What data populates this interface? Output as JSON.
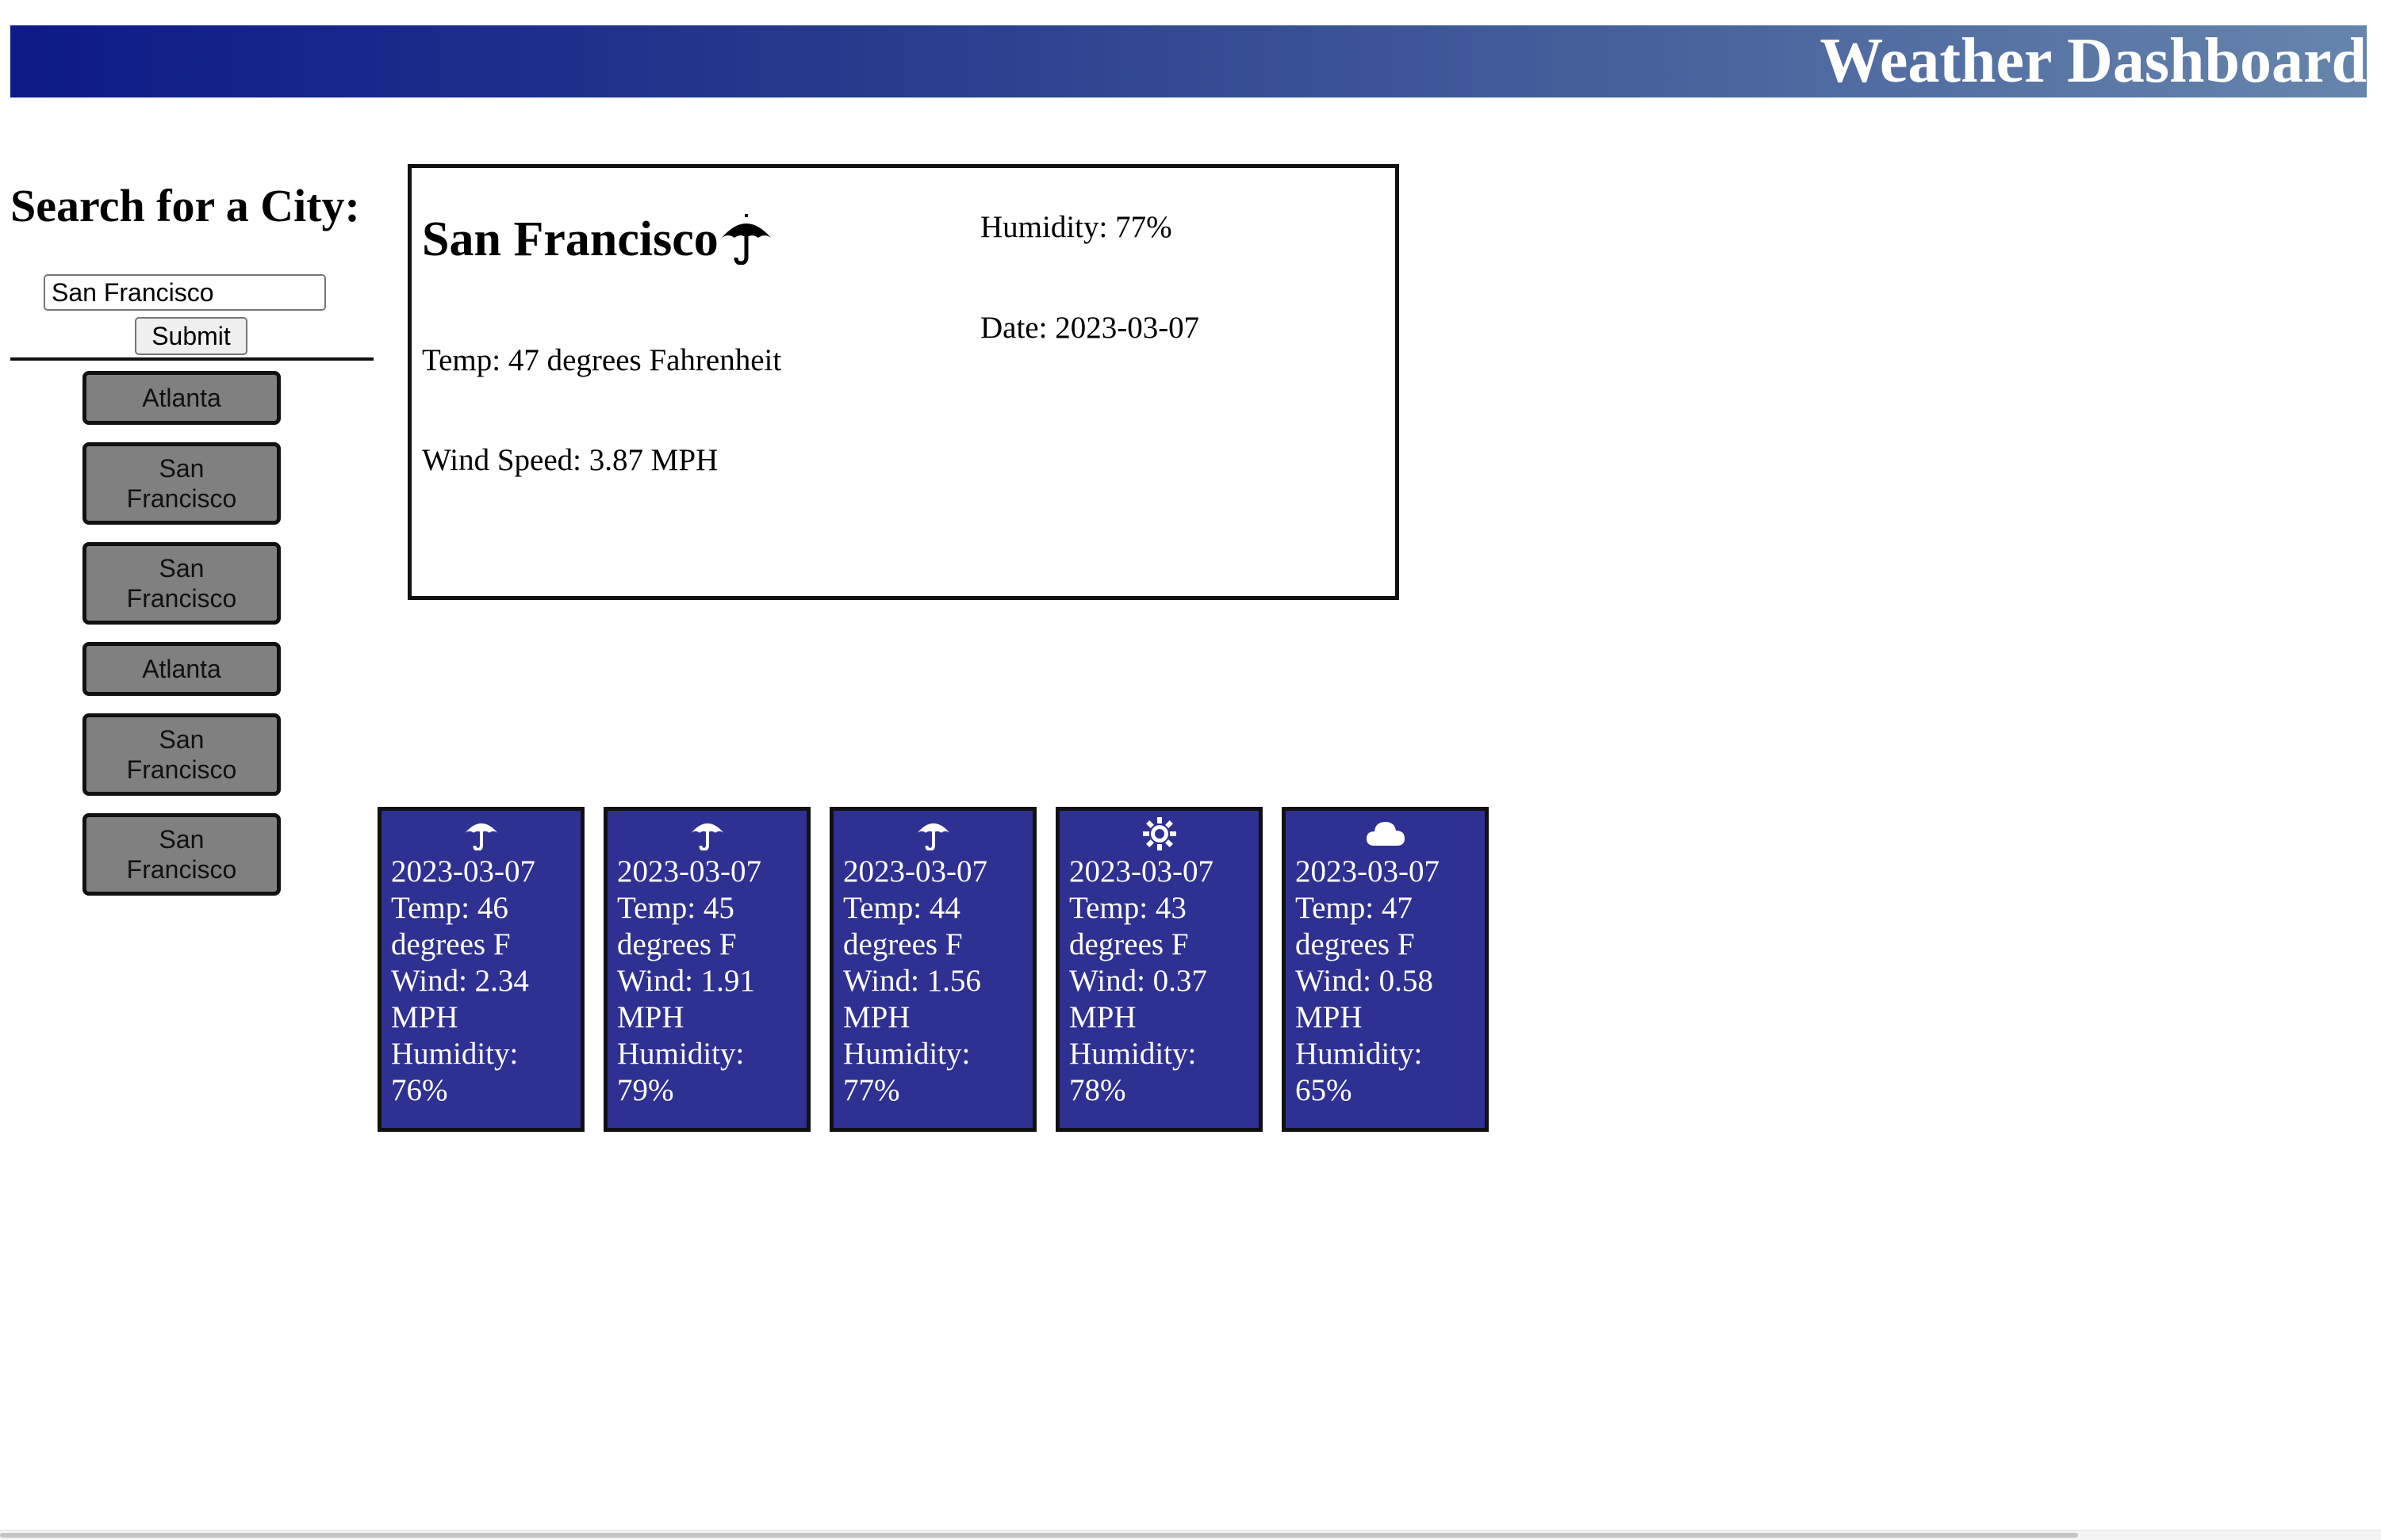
{
  "header": {
    "title": "Weather Dashboard"
  },
  "search": {
    "heading": "Search for a City:",
    "input_value": "San Francisco",
    "submit_label": "Submit"
  },
  "history": [
    {
      "label": "Atlanta"
    },
    {
      "label": "San Francisco"
    },
    {
      "label": "San Francisco"
    },
    {
      "label": "Atlanta"
    },
    {
      "label": "San Francisco"
    },
    {
      "label": "San Francisco"
    }
  ],
  "current": {
    "city": "San Francisco",
    "icon": "umbrella-icon",
    "temp": "Temp: 47 degrees Fahrenheit",
    "wind": "Wind Speed: 3.87 MPH",
    "humidity": "Humidity: 77%",
    "date": "Date: 2023-03-07"
  },
  "forecast": [
    {
      "icon": "umbrella-icon",
      "date": "2023-03-07",
      "temp_a": "Temp: 46",
      "temp_b": "degrees F",
      "wind_a": "Wind: 2.34",
      "wind_b": "MPH",
      "hum_a": "Humidity:",
      "hum_b": "76%"
    },
    {
      "icon": "umbrella-icon",
      "date": "2023-03-07",
      "temp_a": "Temp: 45",
      "temp_b": "degrees F",
      "wind_a": "Wind: 1.91",
      "wind_b": "MPH",
      "hum_a": "Humidity:",
      "hum_b": "79%"
    },
    {
      "icon": "umbrella-icon",
      "date": "2023-03-07",
      "temp_a": "Temp: 44",
      "temp_b": "degrees F",
      "wind_a": "Wind: 1.56",
      "wind_b": "MPH",
      "hum_a": "Humidity:",
      "hum_b": "77%"
    },
    {
      "icon": "sun-icon",
      "date": "2023-03-07",
      "temp_a": "Temp: 43",
      "temp_b": "degrees F",
      "wind_a": "Wind: 0.37",
      "wind_b": "MPH",
      "hum_a": "Humidity:",
      "hum_b": "78%"
    },
    {
      "icon": "cloud-icon",
      "date": "2023-03-07",
      "temp_a": "Temp: 47",
      "temp_b": "degrees F",
      "wind_a": "Wind: 0.58",
      "wind_b": "MPH",
      "hum_a": "Humidity:",
      "hum_b": "65%"
    }
  ],
  "colors": {
    "header_start": "#0d1a87",
    "header_end": "#6685ac",
    "forecast_card": "#2e3092",
    "history_button": "#808080"
  }
}
